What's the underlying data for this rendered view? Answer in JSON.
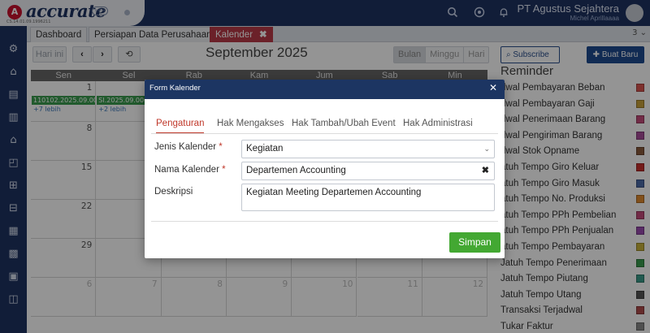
{
  "header": {
    "logo_text": "accurate",
    "logo_sub": "CS.14.01.09.1996211",
    "company_name": "PT Agustus Sejahtera",
    "user_name": "Michel Aprillaaaa"
  },
  "tabs": [
    {
      "label": "Dashboard"
    },
    {
      "label": "Persiapan Data Perusahaan"
    },
    {
      "label": "Kalender",
      "close": "✖"
    }
  ],
  "tab_more": "3 ⌄",
  "calendar": {
    "today_label": "Hari ini",
    "month_title": "September 2025",
    "view_options": [
      "Bulan",
      "Minggu",
      "Hari"
    ],
    "selected_view": "Bulan",
    "day_names": [
      "Sen",
      "Sel",
      "Rab",
      "Kam",
      "Jum",
      "Sab",
      "Min"
    ],
    "rows": [
      [
        "1",
        "",
        "",
        "",
        "",
        "",
        ""
      ],
      [
        "8",
        "",
        "",
        "",
        "",
        "",
        ""
      ],
      [
        "15",
        "",
        "",
        "",
        "",
        "",
        ""
      ],
      [
        "22",
        "",
        "",
        "",
        "",
        "",
        ""
      ],
      [
        "29",
        "",
        "",
        "",
        "",
        "",
        ""
      ],
      [
        "6",
        "7",
        "8",
        "9",
        "10",
        "11",
        "12"
      ]
    ],
    "events": [
      {
        "label": "110102.2025.09.00",
        "more": "+7 lebih"
      },
      {
        "label": "SI.2025.09.000",
        "more": "+2 lebih"
      }
    ]
  },
  "right_panel": {
    "subscribe_label": "Subscribe",
    "new_label": "Buat Baru",
    "reminder_title": "Reminder",
    "reminders": [
      {
        "label": "dwal Pembayaran Beban",
        "color": "#d9534f"
      },
      {
        "label": "dwal Pembayaran Gaji",
        "color": "#c9a13a"
      },
      {
        "label": "dwal Penerimaan Barang",
        "color": "#c44a7a"
      },
      {
        "label": "dwal Pengiriman Barang",
        "color": "#a84a9a"
      },
      {
        "label": "dwal Stok Opname",
        "color": "#8a5a3c"
      },
      {
        "label": "atuh Tempo Giro Keluar",
        "color": "#c9302c"
      },
      {
        "label": "atuh Tempo Giro Masuk",
        "color": "#4a6aa8"
      },
      {
        "label": "atuh Tempo No. Produksi",
        "color": "#e08a30"
      },
      {
        "label": "atuh Tempo PPh Pembelian",
        "color": "#c44a7a"
      },
      {
        "label": "atuh Tempo PPh Penjualan",
        "color": "#9a4ab0"
      },
      {
        "label": "atuh Tempo Pembayaran",
        "color": "#c9b23a"
      },
      {
        "label": "Jatuh Tempo Penerimaan",
        "color": "#3a9c4e"
      },
      {
        "label": "Jatuh Tempo Piutang",
        "color": "#3a9c8a"
      },
      {
        "label": "Jatuh Tempo Utang",
        "color": "#555555"
      },
      {
        "label": "Transaksi Terjadwal",
        "color": "#b04a4a"
      },
      {
        "label": "Tukar Faktur",
        "color": "#888888"
      }
    ]
  },
  "modal": {
    "title": "Form Kalender",
    "close": "✕",
    "tabs": [
      "Pengaturan",
      "Hak Mengakses",
      "Hak Tambah/Ubah Event",
      "Hak Administrasi"
    ],
    "active_tab": "Pengaturan",
    "fields": {
      "jenis_label": "Jenis Kalender",
      "jenis_value": "Kegiatan",
      "nama_label": "Nama Kalender",
      "nama_value": "Departemen Accounting",
      "deskripsi_label": "Deskripsi",
      "deskripsi_value": "Kegiatan Meeting Departemen Accounting",
      "required_mark": "*"
    },
    "save_label": "Simpan"
  },
  "colors": {
    "navy": "#1e3361",
    "tab_active": "#b93a47",
    "save_green": "#43a832",
    "event_green": "#3a9c4e"
  }
}
